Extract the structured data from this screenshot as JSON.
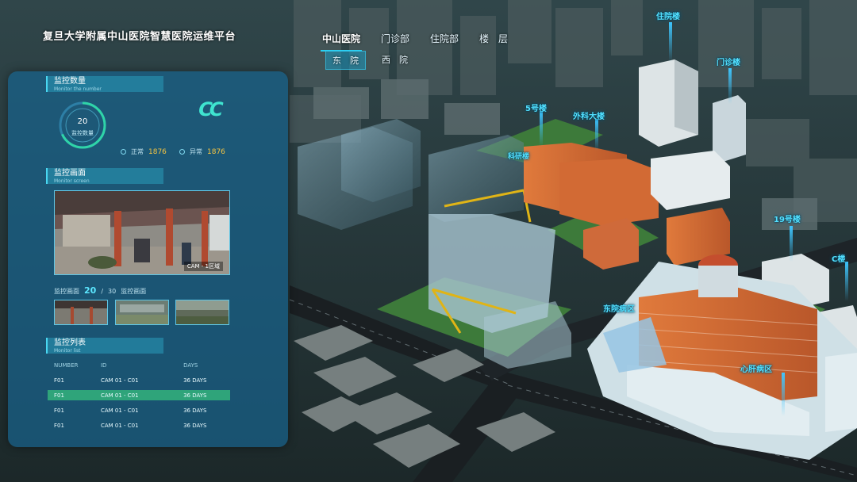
{
  "app_title": "复旦大学附属中山医院智慧医院运维平台",
  "nav": {
    "tabs": [
      {
        "label": "中山医院",
        "active": true
      },
      {
        "label": "门诊部",
        "active": false
      },
      {
        "label": "住院部",
        "active": false
      },
      {
        "label": "楼　层",
        "active": false
      }
    ],
    "campuses": [
      {
        "label": "东　院",
        "active": true
      },
      {
        "label": "西　院",
        "active": false
      }
    ]
  },
  "panel": {
    "monitor_count": {
      "title": "监控数量",
      "subtitle": "Monitor the number",
      "gauge_value": "20",
      "gauge_label": "监控数量",
      "logo_text": "CC",
      "stats": [
        {
          "label": "正常",
          "value": "1876"
        },
        {
          "label": "异常",
          "value": "1876"
        }
      ]
    },
    "monitor_screen": {
      "title": "监控画面",
      "subtitle": "Monitor screen",
      "main_caption": "CAM - 1区域"
    },
    "thumbs": {
      "label_prefix": "监控画面",
      "current": "20",
      "separator": "/",
      "total": "30",
      "label_suffix": "监控画面"
    },
    "monitor_list": {
      "title": "监控列表",
      "subtitle": "Monitor list",
      "headers": [
        "NUMBER",
        "ID",
        "DAYS"
      ],
      "rows": [
        {
          "number": "F01",
          "id": "CAM 01 - C01",
          "days": "36 DAYS",
          "highlight": false
        },
        {
          "number": "F01",
          "id": "CAM 01 - C01",
          "days": "36 DAYS",
          "highlight": true
        },
        {
          "number": "F01",
          "id": "CAM 01 - C01",
          "days": "36 DAYS",
          "highlight": false
        },
        {
          "number": "F01",
          "id": "CAM 01 - C01",
          "days": "36 DAYS",
          "highlight": false
        }
      ]
    }
  },
  "map_labels": {
    "b1": "住院楼",
    "b2": "门诊楼",
    "b3": "5号楼",
    "b4": "外科大楼",
    "b5": "科研楼",
    "b6": "19号楼",
    "b7": "C楼",
    "b8": "东院病区",
    "b9": "心肝病区"
  },
  "colors": {
    "accent": "#29d0f3",
    "panel": "#18628c",
    "highlight_row": "#2fa47a",
    "stat_number": "#f5c542"
  }
}
